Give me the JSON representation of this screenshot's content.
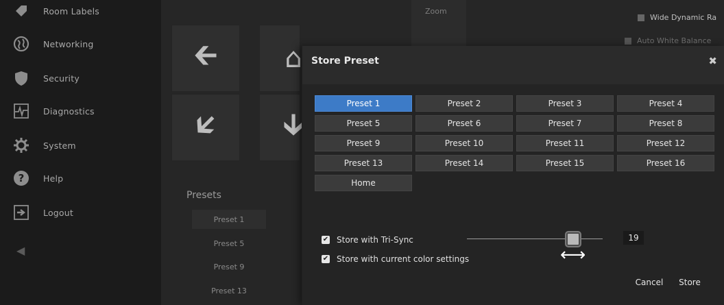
{
  "sidebar": {
    "items": [
      {
        "label": "Room Labels",
        "icon": "tag-icon"
      },
      {
        "label": "Networking",
        "icon": "globe-icon"
      },
      {
        "label": "Security",
        "icon": "shield-icon"
      },
      {
        "label": "Diagnostics",
        "icon": "pulse-icon"
      },
      {
        "label": "System",
        "icon": "gear-icon"
      },
      {
        "label": "Help",
        "icon": "help-icon"
      },
      {
        "label": "Logout",
        "icon": "logout-icon"
      }
    ],
    "collapse_icon": "chevron-left-icon"
  },
  "background": {
    "zoom_label": "Zoom",
    "presets_title": "Presets",
    "preset_list": [
      "Preset 1",
      "Preset 5",
      "Preset 9",
      "Preset 13"
    ],
    "wide_dynamic_range": "Wide Dynamic Ra",
    "auto_white_balance": "Auto White Balance"
  },
  "modal": {
    "title": "Store Preset",
    "close_icon": "close-icon",
    "presets": [
      "Preset 1",
      "Preset 2",
      "Preset 3",
      "Preset 4",
      "Preset 5",
      "Preset 6",
      "Preset 7",
      "Preset 8",
      "Preset 9",
      "Preset 10",
      "Preset 11",
      "Preset 12",
      "Preset 13",
      "Preset 14",
      "Preset 15",
      "Preset 16",
      "Home"
    ],
    "selected_preset": "Preset 1",
    "tri_sync_label": "Store with Tri-Sync",
    "tri_sync_checked": true,
    "color_settings_label": "Store with current color settings",
    "color_settings_checked": true,
    "tri_sync_speed": "19",
    "cancel_label": "Cancel",
    "store_label": "Store"
  },
  "colors": {
    "accent": "#3d7bc7",
    "background": "#1c1c1c",
    "modal": "#2b2b2b"
  }
}
